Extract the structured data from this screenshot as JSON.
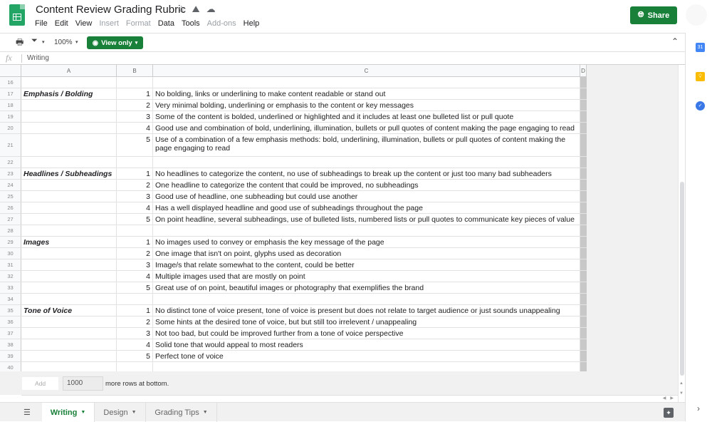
{
  "app": {
    "doc_title": "Content Review Grading Rubric",
    "title_icons": [
      "star-icon",
      "drive-move-icon",
      "cloud-status-icon"
    ],
    "share_label": "Share"
  },
  "menu": [
    "File",
    "Edit",
    "View",
    "Insert",
    "Format",
    "Data",
    "Tools",
    "Add-ons",
    "Help"
  ],
  "menu_disabled": [
    "Insert",
    "Format",
    "Add-ons"
  ],
  "toolbar": {
    "zoom": "100%",
    "view_mode": "View only"
  },
  "formula_bar": {
    "fx_label": "fx",
    "value": "Writing"
  },
  "columns": [
    "A",
    "B",
    "C",
    "D"
  ],
  "rows": [
    {
      "n": "16",
      "a": "",
      "b": "",
      "c": ""
    },
    {
      "n": "17",
      "a": "Emphasis / Bolding",
      "b": "1",
      "c": "No bolding, links or underlining to make content readable or stand out"
    },
    {
      "n": "18",
      "a": "",
      "b": "2",
      "c": "Very minimal bolding, underlining or emphasis to the content or key messages"
    },
    {
      "n": "19",
      "a": "",
      "b": "3",
      "c": "Some of the content is bolded, underlined or highlighted and it includes at least one bulleted list or pull quote"
    },
    {
      "n": "20",
      "a": "",
      "b": "4",
      "c": "Good use and combination of bold, underlining, illumination, bullets or pull quotes of content making the page engaging to read"
    },
    {
      "n": "21",
      "a": "",
      "b": "5",
      "c": "Use of a combination of a few emphasis methods: bold, underlining, illumination, bullets or pull quotes of content making the page engaging to read"
    },
    {
      "n": "22",
      "a": "",
      "b": "",
      "c": ""
    },
    {
      "n": "23",
      "a": "Headlines / Subheadings",
      "b": "1",
      "c": "No headlines to categorize the content, no use of subheadings to break up the content or just too many bad subheaders"
    },
    {
      "n": "24",
      "a": "",
      "b": "2",
      "c": "One headline to categorize the content that could be improved, no subheadings"
    },
    {
      "n": "25",
      "a": "",
      "b": "3",
      "c": "Good use of headline, one subheading but could use another"
    },
    {
      "n": "26",
      "a": "",
      "b": "4",
      "c": "Has a well displayed headline and good use of subheadings throughout the page"
    },
    {
      "n": "27",
      "a": "",
      "b": "5",
      "c": "On point headline, several subheadings, use of bulleted lists, numbered lists or pull quotes to communicate key pieces of value"
    },
    {
      "n": "28",
      "a": "",
      "b": "",
      "c": ""
    },
    {
      "n": "29",
      "a": "Images",
      "b": "1",
      "c": "No images used to convey or emphasis the key message of the page"
    },
    {
      "n": "30",
      "a": "",
      "b": "2",
      "c": "One image that isn't on point, glyphs used as decoration"
    },
    {
      "n": "31",
      "a": "",
      "b": "3",
      "c": "Image/s that relate somewhat to the content, could be better"
    },
    {
      "n": "32",
      "a": "",
      "b": "4",
      "c": "Multiple images used that are mostly on point"
    },
    {
      "n": "33",
      "a": "",
      "b": "5",
      "c": "Great use of on point, beautiful images or photography that exemplifies the brand"
    },
    {
      "n": "34",
      "a": "",
      "b": "",
      "c": ""
    },
    {
      "n": "35",
      "a": "Tone of Voice",
      "b": "1",
      "c": "No distinct tone of voice present, tone of voice is present but does not relate to target audience or just sounds unappealing"
    },
    {
      "n": "36",
      "a": "",
      "b": "2",
      "c": "Some hints at the desired tone of voice, but but still too irrelevent / unappealing"
    },
    {
      "n": "37",
      "a": "",
      "b": "3",
      "c": "Not too bad, but could be improved further from a tone of voice perspective"
    },
    {
      "n": "38",
      "a": "",
      "b": "4",
      "c": "Solid tone that would appeal to most readers"
    },
    {
      "n": "39",
      "a": "",
      "b": "5",
      "c": "Perfect tone of voice"
    },
    {
      "n": "40",
      "a": "",
      "b": "",
      "c": ""
    }
  ],
  "add_rows": {
    "button_label": "Add",
    "count": "1000",
    "suffix": "more rows at bottom."
  },
  "sheet_tabs": [
    {
      "label": "Writing",
      "active": true
    },
    {
      "label": "Design",
      "active": false
    },
    {
      "label": "Grading Tips",
      "active": false
    }
  ],
  "side_panel": [
    "calendar-icon",
    "keep-icon",
    "tasks-icon"
  ],
  "colors": {
    "brand_green": "#188038",
    "sheets_green": "#23a566",
    "calendar_blue": "#4285f4",
    "keep_yellow": "#fbbc04",
    "tasks_blue": "#3b78e7"
  }
}
